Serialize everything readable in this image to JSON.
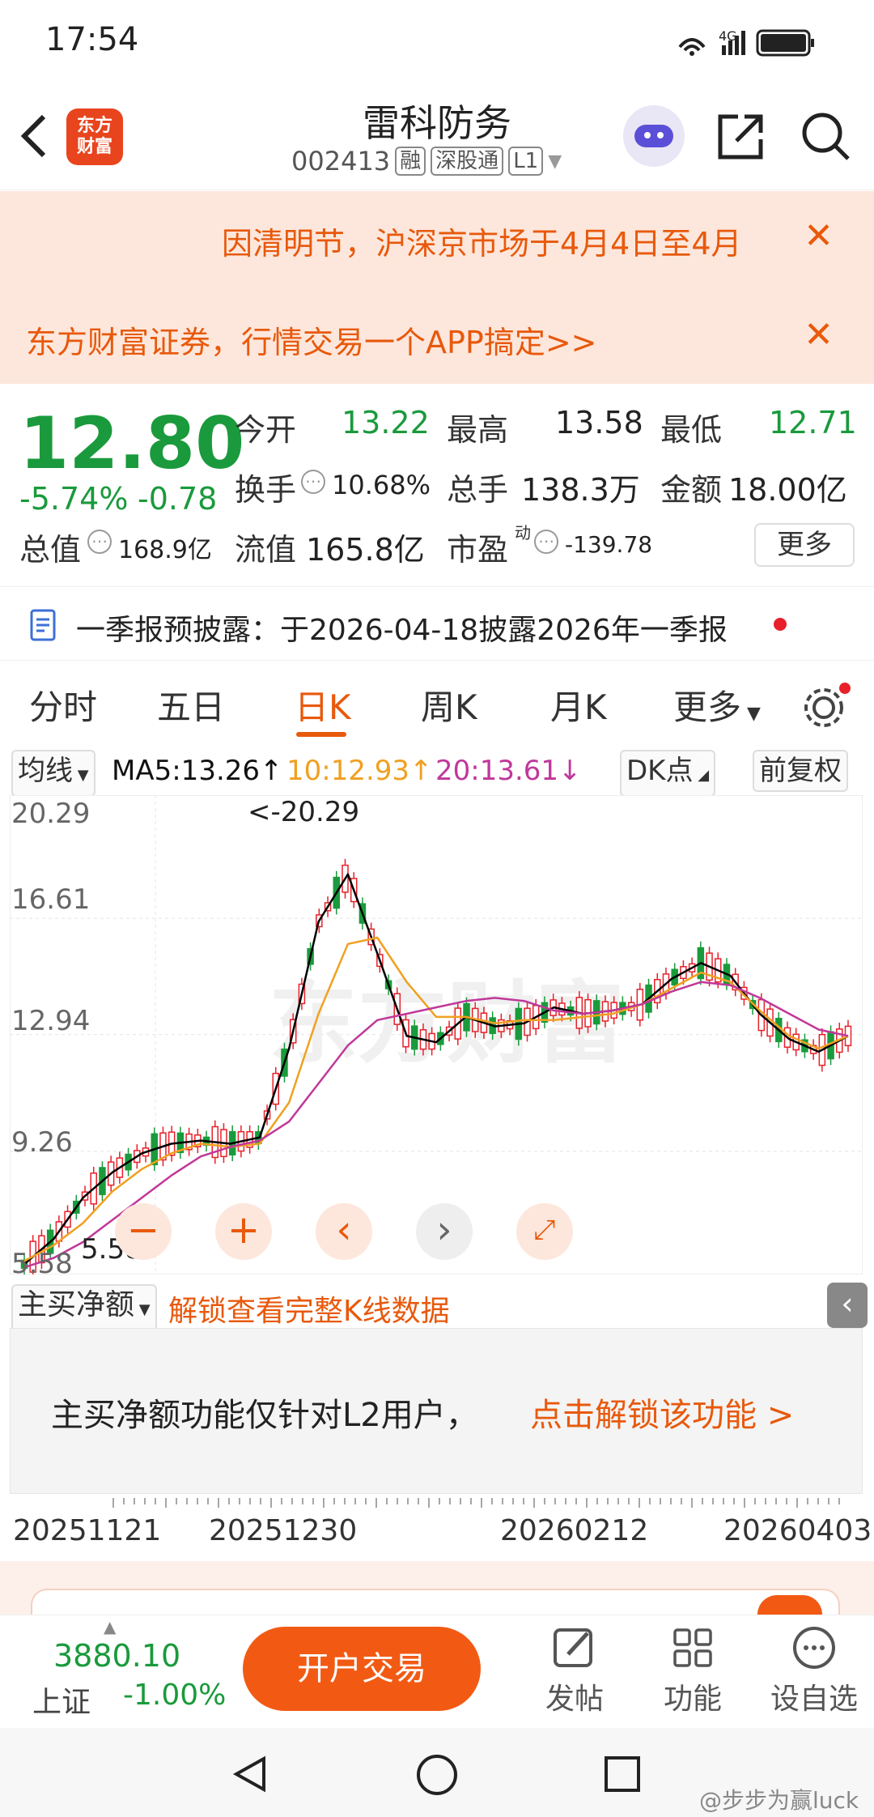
{
  "status": {
    "time": "17:54",
    "network": "4G"
  },
  "header": {
    "title": "雷科防务",
    "code": "002413",
    "tags": [
      "融",
      "深股通",
      "L1"
    ],
    "logo_line1": "东方",
    "logo_line2": "财富"
  },
  "banners": [
    {
      "text": "因清明节，沪深京市场于4月4日至4月"
    },
    {
      "text": "东方财富证券，行情交易一个APP搞定>>"
    }
  ],
  "quote": {
    "price": "12.80",
    "change_pct": "-5.74%",
    "change_abs": "-0.78",
    "open_label": "今开",
    "open": "13.22",
    "high_label": "最高",
    "high": "13.58",
    "low_label": "最低",
    "low": "12.71",
    "turnover_label": "换手",
    "turnover": "10.68%",
    "volume_label": "总手",
    "volume": "138.3万",
    "amount_label": "金额",
    "amount": "18.00亿",
    "mktcap_label": "总值",
    "mktcap": "168.9亿",
    "float_label": "流值",
    "float": "165.8亿",
    "pe_label": "市盈",
    "pe_sup": "动",
    "pe": "-139.78",
    "more": "更多"
  },
  "notice": {
    "text": "一季报预披露：于2026-04-18披露2026年一季报"
  },
  "tabs": [
    {
      "label": "分时"
    },
    {
      "label": "五日"
    },
    {
      "label": "日K"
    },
    {
      "label": "周K"
    },
    {
      "label": "月K"
    },
    {
      "label": "更多"
    }
  ],
  "ma_bar": {
    "type": "均线",
    "ma5": "MA5:13.26↑",
    "ma10": "10:12.93↑",
    "ma20": "20:13.61↓",
    "dk": "DK点",
    "adjust": "前复权"
  },
  "chart": {
    "y_labels": [
      "20.29",
      "16.61",
      "12.94",
      "9.26",
      "5.58"
    ],
    "high_marker": "<-20.29",
    "low_marker": "5.58",
    "watermark": "东方财富"
  },
  "chart_data": {
    "type": "line",
    "ylim": [
      5.58,
      20.29
    ],
    "series": [
      {
        "name": "MA5",
        "color": "#000000",
        "values": [
          5.7,
          6.5,
          7.8,
          8.6,
          9.2,
          9.5,
          9.6,
          9.5,
          9.7,
          12.5,
          16.5,
          18.0,
          15.5,
          12.9,
          12.7,
          13.5,
          13.2,
          13.3,
          13.8,
          13.6,
          13.7,
          13.9,
          14.7,
          15.2,
          14.8,
          13.6,
          12.8,
          12.4,
          12.9
        ]
      },
      {
        "name": "MA10",
        "color": "#f0a020",
        "values": [
          5.8,
          6.3,
          7.0,
          8.0,
          8.7,
          9.2,
          9.5,
          9.4,
          9.5,
          10.8,
          13.6,
          15.8,
          16.0,
          14.6,
          13.5,
          13.5,
          13.3,
          13.4,
          13.4,
          13.5,
          13.6,
          13.9,
          14.4,
          14.9,
          14.6,
          13.7,
          12.9,
          12.5,
          12.9
        ]
      },
      {
        "name": "MA20",
        "color": "#c0389a",
        "values": [
          5.6,
          5.9,
          6.4,
          7.1,
          7.8,
          8.5,
          9.1,
          9.4,
          9.6,
          10.2,
          11.4,
          12.6,
          13.4,
          13.6,
          13.8,
          14.0,
          14.1,
          14.0,
          13.7,
          13.6,
          13.7,
          13.9,
          14.3,
          14.6,
          14.5,
          14.1,
          13.6,
          13.1,
          12.9
        ]
      }
    ]
  },
  "indicator": {
    "name": "主买净额",
    "unlock": "解锁查看完整K线数据"
  },
  "lock": {
    "text": "主买净额功能仅针对L2用户，",
    "link": "点击解锁该功能 >"
  },
  "dates": [
    "20251121",
    "20251230",
    "20260212",
    "20260403"
  ],
  "bottom": {
    "index_value": "3880.10",
    "index_name": "上证",
    "index_change": "-1.00%",
    "trade": "开户交易",
    "nav": [
      {
        "label": "发帖"
      },
      {
        "label": "功能"
      },
      {
        "label": "设自选"
      }
    ]
  },
  "watermark_user": "@步步为赢luck"
}
